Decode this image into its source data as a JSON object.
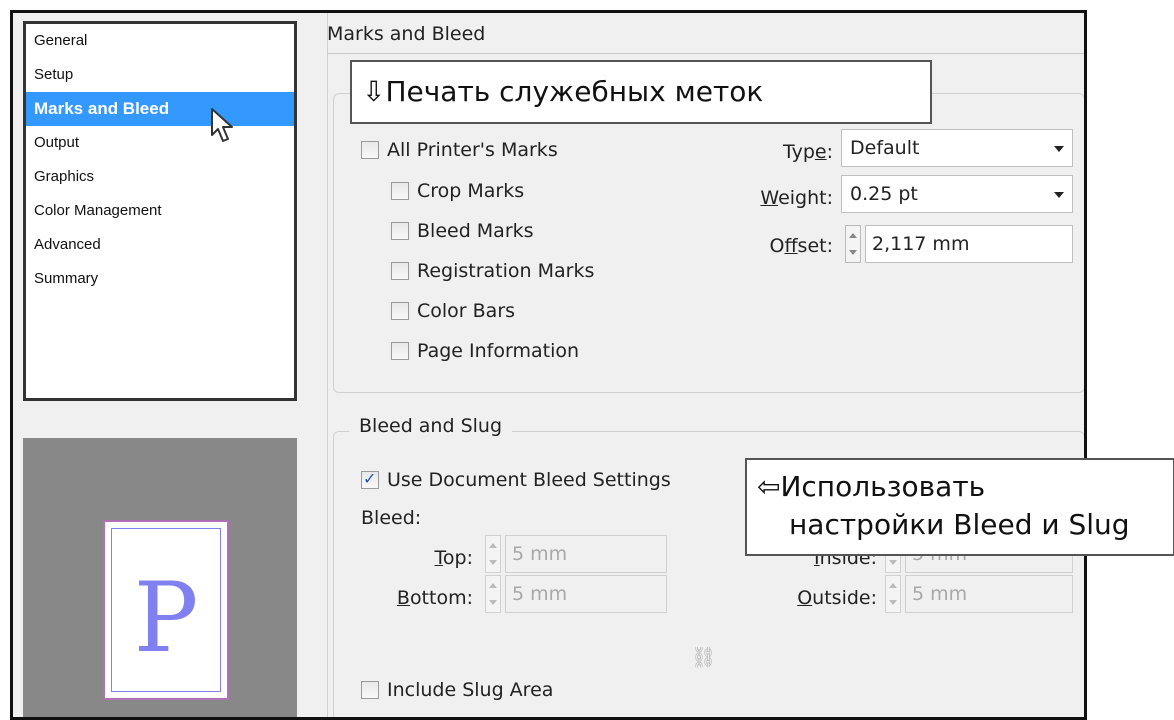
{
  "nav": {
    "items": [
      {
        "label": "General"
      },
      {
        "label": "Setup"
      },
      {
        "label": "Marks and Bleed"
      },
      {
        "label": "Output"
      },
      {
        "label": "Graphics"
      },
      {
        "label": "Color Management"
      },
      {
        "label": "Advanced"
      },
      {
        "label": "Summary"
      }
    ],
    "selected": "Marks and Bleed"
  },
  "preview": {
    "letter": "P"
  },
  "panel": {
    "title": "Marks and Bleed",
    "marks": {
      "all_printers_marks": {
        "label": "All Printer's Marks",
        "checked": false
      },
      "crop_marks": {
        "label": "Crop Marks",
        "checked": false
      },
      "bleed_marks": {
        "label": "Bleed Marks",
        "checked": false
      },
      "registration_marks": {
        "label": "Registration Marks",
        "checked": false
      },
      "color_bars": {
        "label": "Color Bars",
        "checked": false
      },
      "page_information": {
        "label": "Page Information",
        "checked": false
      },
      "type": {
        "label_pre": "Typ",
        "label_ul": "e",
        "label_post": ":",
        "value": "Default"
      },
      "weight": {
        "label_pre": "",
        "label_ul": "W",
        "label_post": "eight:",
        "value": "0.25 pt"
      },
      "offset": {
        "label_pre": "O",
        "label_ul": "f",
        "label_post": "fset:",
        "value": "2,117 mm"
      }
    },
    "bleed_slug": {
      "legend": "Bleed and Slug",
      "use_document_bleed": {
        "label": "Use Document Bleed Settings",
        "checked": true
      },
      "bleed_label": "Bleed:",
      "top": {
        "label_ul": "T",
        "label_rest": "op:",
        "value": "5 mm"
      },
      "bottom": {
        "label_ul": "B",
        "label_rest": "ottom:",
        "value": "5 mm"
      },
      "inside": {
        "label_ul": "I",
        "label_rest": "nside:",
        "value": "5 mm"
      },
      "outside": {
        "label_ul": "O",
        "label_rest": "utside:",
        "value": "5 mm"
      },
      "include_slug": {
        "label": "Include Slug Area",
        "checked": false
      }
    }
  },
  "annotations": {
    "marks_note": "⇩Печать служебных меток",
    "bleed_note_line1": "⇦Использовать",
    "bleed_note_line2": "настройки Bleed и Slug"
  },
  "colors": {
    "selection": "#3399ff",
    "preview_bg": "#888888",
    "page_border": "#b070b8",
    "letter": "#8080f0"
  }
}
